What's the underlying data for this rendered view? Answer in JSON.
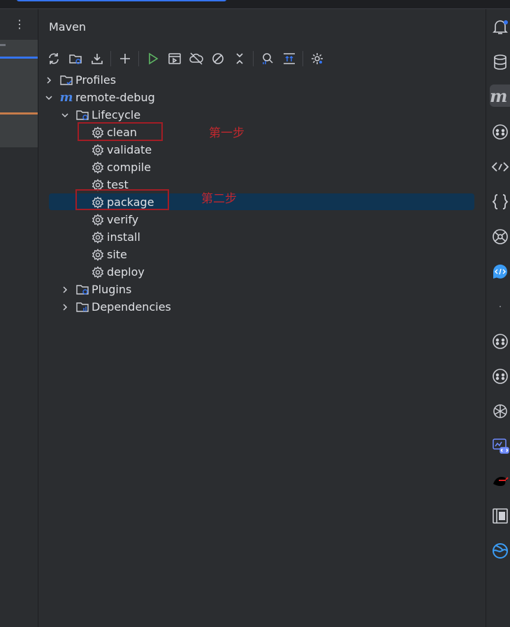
{
  "panel": {
    "title": "Maven"
  },
  "left": {
    "menu": "⋮"
  },
  "toolbar": [
    {
      "name": "reload-icon"
    },
    {
      "name": "reimport-folder-icon"
    },
    {
      "name": "download-icon"
    },
    {
      "name": "add-icon"
    },
    {
      "name": "run-icon"
    },
    {
      "name": "run-config-icon"
    },
    {
      "name": "offline-icon"
    },
    {
      "name": "skip-tests-icon"
    },
    {
      "name": "collapse-icon"
    },
    {
      "name": "show-dependencies-icon"
    },
    {
      "name": "expand-all-icon"
    },
    {
      "name": "settings-icon"
    }
  ],
  "tree": {
    "profiles": "Profiles",
    "project": "remote-debug",
    "lifecycle": "Lifecycle",
    "goals": [
      "clean",
      "validate",
      "compile",
      "test",
      "package",
      "verify",
      "install",
      "site",
      "deploy"
    ],
    "plugins": "Plugins",
    "dependencies": "Dependencies"
  },
  "annotations": {
    "step1": "第一步",
    "step2": "第二步"
  },
  "rightbar": {
    "maven_letter": "m",
    "icons": [
      "notifications-icon",
      "database-icon",
      "maven-icon",
      "copilot-icon",
      "endpoints-icon",
      "json-icon",
      "ai-icon",
      "code-chat-icon",
      "dot-icon",
      "copilot-icon",
      "copilot-icon",
      "openai-icon",
      "code-preview-icon",
      "ninja-icon",
      "document-icon",
      "globe-icon"
    ]
  },
  "colors": {
    "accent": "#3574f0",
    "selection": "#0f3452",
    "annotation": "#c0282e",
    "run": "#5fb865"
  }
}
